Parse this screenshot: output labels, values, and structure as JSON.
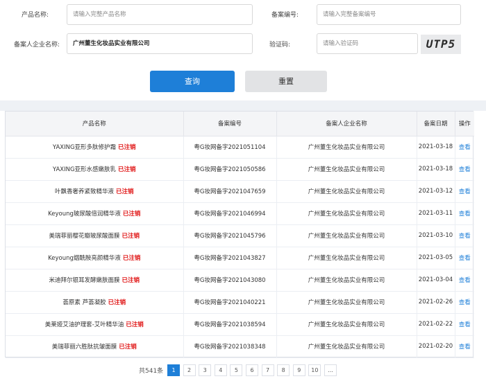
{
  "search": {
    "product_name_label": "产品名称:",
    "product_name_placeholder": "请输入完整产品名称",
    "record_no_label": "备案编号:",
    "record_no_placeholder": "请输入完整备案编号",
    "company_label": "备案人企业名称:",
    "company_value": "广州董生化妆品实业有限公司",
    "captcha_label": "验证码:",
    "captcha_placeholder": "请输入验证码",
    "captcha_text": "UTP5",
    "query_button": "查询",
    "reset_button": "重置"
  },
  "table": {
    "headers": [
      "产品名称",
      "备案编号",
      "备案人企业名称",
      "备案日期",
      "操作"
    ],
    "cancel_tag": "已注销",
    "view_label": "查看",
    "rows": [
      {
        "name": "YAXING亚形多肽修护霜",
        "no": "粤G妆网备字2021051104",
        "company": "广州董生化妆品实业有限公司",
        "date": "2021-03-18"
      },
      {
        "name": "YAXING亚形水感嫩肤乳",
        "no": "粤G妆网备字2021050586",
        "company": "广州董生化妆品实业有限公司",
        "date": "2021-03-18"
      },
      {
        "name": "叶飘香奢养紧致精华液",
        "no": "粤G妆网备字2021047659",
        "company": "广州董生化妆品实业有限公司",
        "date": "2021-03-12"
      },
      {
        "name": "Keyoung玻尿酸倍润精华液",
        "no": "粤G妆网备字2021046994",
        "company": "广州董生化妆品实业有限公司",
        "date": "2021-03-11"
      },
      {
        "name": "美瑞菲丽樱花瓣玻尿酸面膜",
        "no": "粤G妆网备字2021045796",
        "company": "广州董生化妆品实业有限公司",
        "date": "2021-03-10"
      },
      {
        "name": "Keyoung烟酰胺亮颜精华液",
        "no": "粤G妆网备字2021043827",
        "company": "广州董生化妆品实业有限公司",
        "date": "2021-03-05"
      },
      {
        "name": "米迪拜尔银耳发酵嫩肤面膜",
        "no": "粤G妆网备字2021043080",
        "company": "广州董生化妆品实业有限公司",
        "date": "2021-03-04"
      },
      {
        "name": "荟原素 芦荟凝胶",
        "no": "粤G妆网备字2021040221",
        "company": "广州董生化妆品实业有限公司",
        "date": "2021-02-26"
      },
      {
        "name": "美莱娅艾油护理套-艾叶精华油",
        "no": "粤G妆网备字2021038594",
        "company": "广州董生化妆品实业有限公司",
        "date": "2021-02-22"
      },
      {
        "name": "美瑞菲丽六胜肽抗皱面膜",
        "no": "粤G妆网备字2021038348",
        "company": "广州董生化妆品实业有限公司",
        "date": "2021-02-20"
      }
    ]
  },
  "pagination": {
    "total": "共541条",
    "pages": [
      "1",
      "2",
      "3",
      "4",
      "5",
      "6",
      "7",
      "8",
      "9",
      "10",
      "..."
    ],
    "current": "1"
  }
}
